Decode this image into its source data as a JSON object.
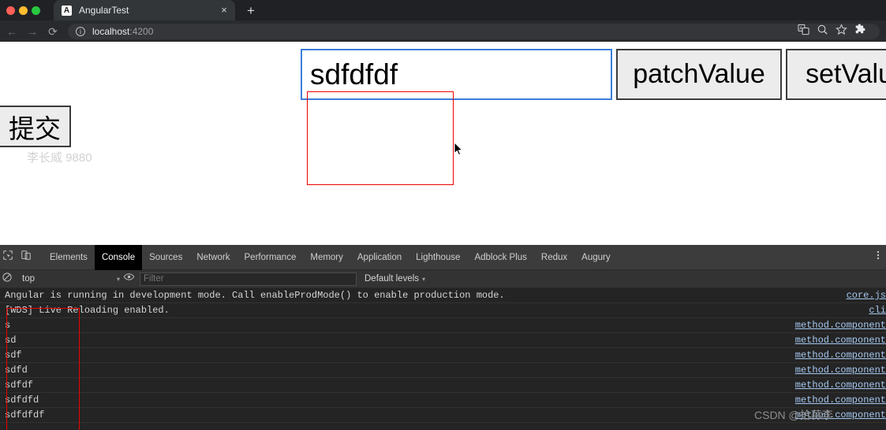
{
  "browser": {
    "tab": {
      "title": "AngularTest",
      "favicon_letter": "A"
    },
    "new_tab_label": "+",
    "close_label": "×",
    "nav": {
      "back": "←",
      "forward": "→",
      "reload": "⟳"
    },
    "omnibox": {
      "host": "localhost",
      "port": ":4200",
      "info_icon": "i"
    },
    "toolbar_icons": [
      "translate-icon",
      "search-icon",
      "bookmark-star-icon",
      "extensions-puzzle-icon"
    ]
  },
  "page": {
    "input": {
      "value": "sdfdfdf",
      "placeholder": ""
    },
    "buttons": {
      "patch": "patchValue",
      "set": "setValue",
      "submit": "提交"
    },
    "watermark": "李长威 9880"
  },
  "devtools": {
    "tabs": [
      {
        "label": "Elements",
        "active": false
      },
      {
        "label": "Console",
        "active": true
      },
      {
        "label": "Sources",
        "active": false
      },
      {
        "label": "Network",
        "active": false
      },
      {
        "label": "Performance",
        "active": false
      },
      {
        "label": "Memory",
        "active": false
      },
      {
        "label": "Application",
        "active": false
      },
      {
        "label": "Lighthouse",
        "active": false
      },
      {
        "label": "Adblock Plus",
        "active": false
      },
      {
        "label": "Redux",
        "active": false
      },
      {
        "label": "Augury",
        "active": false
      }
    ],
    "filterbar": {
      "context": "top",
      "filter_placeholder": "Filter",
      "levels": "Default levels",
      "caret": "▾"
    },
    "console_rows": [
      {
        "text": "Angular is running in development mode. Call enableProdMode() to enable production mode.",
        "source": "core.js"
      },
      {
        "text": "[WDS] Live Reloading enabled.",
        "source": "cli"
      },
      {
        "text": "s",
        "source": "method.component"
      },
      {
        "text": "sd",
        "source": "method.component"
      },
      {
        "text": "sdf",
        "source": "method.component"
      },
      {
        "text": "sdfd",
        "source": "method.component"
      },
      {
        "text": "sdfdf",
        "source": "method.component"
      },
      {
        "text": "sdfdfd",
        "source": "method.component"
      },
      {
        "text": "sdfdfdf",
        "source": "method.component"
      }
    ],
    "watermark": "CSDN @拾蒜李"
  }
}
